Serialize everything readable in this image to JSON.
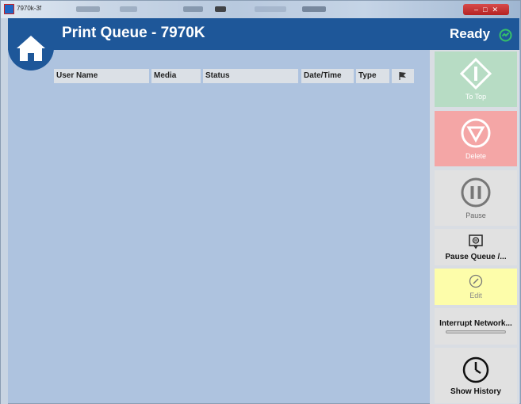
{
  "window": {
    "title": "7970k-3f"
  },
  "header": {
    "title": "Print Queue - 7970K",
    "status": "Ready"
  },
  "table": {
    "columns": [
      {
        "label": "User Name"
      },
      {
        "label": "Media"
      },
      {
        "label": "Status"
      },
      {
        "label": "Date/Time"
      },
      {
        "label": "Type"
      }
    ],
    "rows": []
  },
  "actions": {
    "to_top": "To Top",
    "delete": "Delete",
    "pause": "Pause",
    "pause_queue": "Pause Queue /...",
    "edit": "Edit",
    "interrupt_network": "Interrupt Network...",
    "show_history": "Show History"
  },
  "colors": {
    "header_bg": "#1e5799",
    "workspace_bg": "#aec3df",
    "to_top_bg": "#b7dcc4",
    "delete_bg": "#f4a6a6",
    "edit_bg": "#fdfdaa",
    "ready_icon": "#35c06a"
  },
  "icons": {
    "home": "home-icon",
    "status": "status-ready-icon",
    "flag": "flag-icon",
    "to_top": "to-top-icon",
    "delete": "delete-icon",
    "pause": "pause-icon",
    "pause_queue": "pause-queue-icon",
    "edit": "edit-icon",
    "show_history": "clock-icon"
  }
}
